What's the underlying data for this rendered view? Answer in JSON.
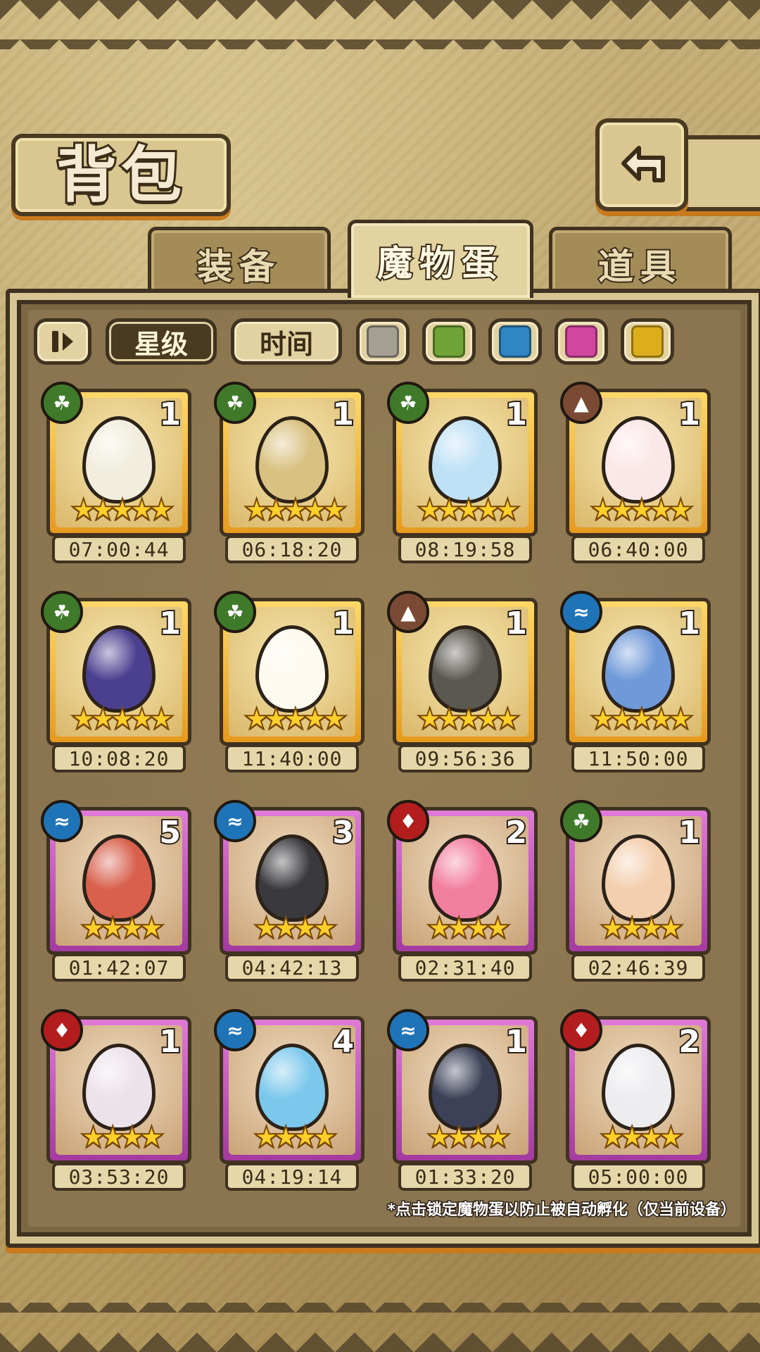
{
  "header": {
    "title": "背包"
  },
  "tabs": [
    {
      "label": "装备",
      "active": false
    },
    {
      "label": "魔物蛋",
      "active": true
    },
    {
      "label": "道具",
      "active": false
    }
  ],
  "filters": {
    "sort_star": "星级",
    "sort_time": "时间",
    "colors": [
      "#a59f92",
      "#6fa335",
      "#2f86c2",
      "#d1469f",
      "#dcae1c"
    ]
  },
  "eggs": [
    {
      "element": "nature",
      "count": "1",
      "stars": 5,
      "rarity": "gold",
      "time": "07:00:44",
      "color": "#f1eede"
    },
    {
      "element": "nature",
      "count": "1",
      "stars": 5,
      "rarity": "gold",
      "time": "06:18:20",
      "color": "#d9c181"
    },
    {
      "element": "nature",
      "count": "1",
      "stars": 5,
      "rarity": "gold",
      "time": "08:19:58",
      "color": "#bfe1f6"
    },
    {
      "element": "earth",
      "count": "1",
      "stars": 5,
      "rarity": "gold",
      "time": "06:40:00",
      "color": "#fbe7e7"
    },
    {
      "element": "nature",
      "count": "1",
      "stars": 5,
      "rarity": "gold",
      "time": "10:08:20",
      "color": "#4b3f8f"
    },
    {
      "element": "nature",
      "count": "1",
      "stars": 5,
      "rarity": "gold",
      "time": "11:40:00",
      "color": "#fffaf0"
    },
    {
      "element": "earth",
      "count": "1",
      "stars": 5,
      "rarity": "gold",
      "time": "09:56:36",
      "color": "#5a5850"
    },
    {
      "element": "water",
      "count": "1",
      "stars": 5,
      "rarity": "gold",
      "time": "11:50:00",
      "color": "#6f99d8"
    },
    {
      "element": "water",
      "count": "5",
      "stars": 4,
      "rarity": "purple",
      "time": "01:42:07",
      "color": "#d8604c"
    },
    {
      "element": "water",
      "count": "3",
      "stars": 4,
      "rarity": "purple",
      "time": "04:42:13",
      "color": "#3a3a3e"
    },
    {
      "element": "fire",
      "count": "2",
      "stars": 4,
      "rarity": "purple",
      "time": "02:31:40",
      "color": "#f27fa0"
    },
    {
      "element": "nature",
      "count": "1",
      "stars": 4,
      "rarity": "purple",
      "time": "02:46:39",
      "color": "#f3cfae"
    },
    {
      "element": "fire",
      "count": "1",
      "stars": 4,
      "rarity": "purple",
      "time": "03:53:20",
      "color": "#ece2ea"
    },
    {
      "element": "water",
      "count": "4",
      "stars": 4,
      "rarity": "purple",
      "time": "04:19:14",
      "color": "#7cc8ec"
    },
    {
      "element": "water",
      "count": "1",
      "stars": 4,
      "rarity": "purple",
      "time": "01:33:20",
      "color": "#3c4157"
    },
    {
      "element": "fire",
      "count": "2",
      "stars": 4,
      "rarity": "purple",
      "time": "05:00:00",
      "color": "#ededf0"
    }
  ],
  "element_colors": {
    "nature": "#3f7a2a",
    "earth": "#7a4a34",
    "water": "#1f74b8",
    "fire": "#b41d1d"
  },
  "footnote": "*点击锁定魔物蛋以防止被自动孵化（仅当前设备）"
}
